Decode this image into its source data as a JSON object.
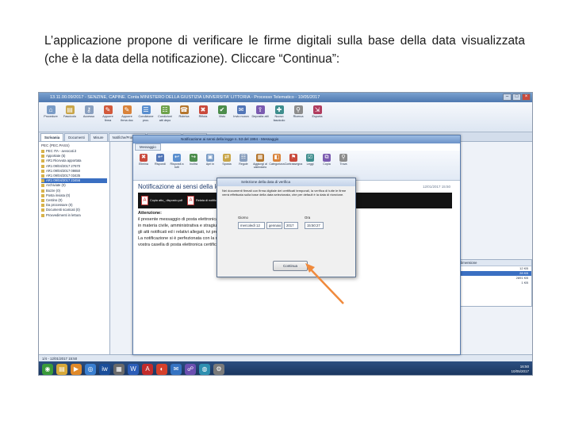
{
  "caption": "L’applicazione propone di verificare le firme digitali sulla base della data visualizzata (che è la data della notificazione). Cliccare “Continua”:",
  "app": {
    "title": "13.11.00.09/2017 - SENZINE, CAPINE. Conta MINISTERO DELLA GIUSTIZIA UNIVERSITA' LITTORIA - Processo Telematico - 10/05/2017"
  },
  "ribbon": [
    {
      "label": "Procedure",
      "icon": "⌂",
      "color": "#7a9cc6"
    },
    {
      "label": "Fascicolo",
      "icon": "▤",
      "color": "#c9a64a"
    },
    {
      "label": "Accesso",
      "icon": "⚷",
      "color": "#8aa0bf"
    },
    {
      "label": "Apporre firma",
      "icon": "✎",
      "color": "#d25a3c"
    },
    {
      "label": "Apporre firma doc",
      "icon": "✎",
      "color": "#d9833b"
    },
    {
      "label": "Condizione proc.",
      "icon": "☰",
      "color": "#5a8fcf"
    },
    {
      "label": "Condizioni atti depo",
      "icon": "☷",
      "color": "#6ea24b"
    },
    {
      "label": "Rubrica",
      "icon": "☎",
      "color": "#b4762e"
    },
    {
      "label": "Rifiuta",
      "icon": "✖",
      "color": "#c94a3c"
    },
    {
      "label": "Visto",
      "icon": "✔",
      "color": "#4c8d4c"
    },
    {
      "label": "Invio nuovo",
      "icon": "✉",
      "color": "#5276b7"
    },
    {
      "label": "Deposita atti",
      "icon": "⇪",
      "color": "#7b5bb0"
    },
    {
      "label": "Nuovo fascicolo",
      "icon": "✚",
      "color": "#3f8e8e"
    },
    {
      "label": "Ricerca",
      "icon": "⚲",
      "color": "#8c8c8c"
    },
    {
      "label": "Esporta",
      "icon": "⇲",
      "color": "#b03c5e"
    }
  ],
  "tabs": [
    {
      "label": "Scrivania",
      "active": true
    },
    {
      "label": "Documenti",
      "active": false
    },
    {
      "label": "Misure",
      "active": false
    },
    {
      "label": "Notifiche/Procedure",
      "active": false
    },
    {
      "label": "Gestione fascicoli",
      "active": false
    },
    {
      "label": "Calendario",
      "active": false
    }
  ],
  "sidebar": {
    "header": "PEC (PEC.PASS)",
    "items": [
      {
        "label": "PEC ITA - avvocati.it",
        "selected": false
      },
      {
        "label": "Apportate (5)",
        "selected": false
      },
      {
        "label": "AR1 Ricevuta apportata",
        "selected": false
      },
      {
        "label": "AR1 09/04/2017 27670",
        "selected": false
      },
      {
        "label": "AR1 09/04/2017 08650",
        "selected": false
      },
      {
        "label": "AR1 09/04/2017 03435",
        "selected": false
      },
      {
        "label": "AR1 09/04/2017 23456",
        "selected": true
      },
      {
        "label": "Archiviate (0)",
        "selected": false
      },
      {
        "label": "Bozze (0)",
        "selected": false
      },
      {
        "label": "Posta inviata (0)",
        "selected": false
      },
      {
        "label": "Cestino (0)",
        "selected": false
      },
      {
        "label": "Da processare (0)",
        "selected": false
      },
      {
        "label": "Documenti scaricati (0)",
        "selected": false
      },
      {
        "label": "Provvedimenti in lettura",
        "selected": false
      }
    ]
  },
  "message_window": {
    "title": "Notificazione ai sensi della legge n. 53 del 1994 - Messaggio",
    "tab": "Messaggio",
    "ribbon": [
      {
        "label": "Elimina",
        "icon": "✖",
        "color": "#c94a3c"
      },
      {
        "label": "Rispondi",
        "icon": "↩",
        "color": "#5276b7"
      },
      {
        "label": "Rispondi a tutti",
        "icon": "↩",
        "color": "#5a8fcf"
      },
      {
        "label": "Inoltra",
        "icon": "↪",
        "color": "#4c8d4c"
      },
      {
        "label": "Apri in",
        "icon": "▣",
        "color": "#7a9cc6"
      },
      {
        "label": "Sposta",
        "icon": "⇄",
        "color": "#c9a64a"
      },
      {
        "label": "Regole",
        "icon": "☷",
        "color": "#8aa0bf"
      },
      {
        "label": "Aggiungi al calendario",
        "icon": "▦",
        "color": "#b4762e"
      },
      {
        "label": "Categorizza",
        "icon": "◧",
        "color": "#d9833b"
      },
      {
        "label": "Contrassegna",
        "icon": "⚑",
        "color": "#c94a3c"
      },
      {
        "label": "Leggi",
        "icon": "☑",
        "color": "#3f8e8e"
      },
      {
        "label": "Copia",
        "icon": "⧉",
        "color": "#7b5bb0"
      },
      {
        "label": "Trova",
        "icon": "⚲",
        "color": "#8c8c8c"
      }
    ],
    "subject": "Notificazione ai sensi della legge n. 53 del 1994",
    "date": "12/01/2017 15:50",
    "attachments": [
      {
        "name": "Copia atto_ disposto.pdf"
      },
      {
        "name": "Relata di notifica.pdf"
      },
      {
        "name": "Procura.pdf"
      }
    ],
    "body": {
      "heading": "Attenzione:",
      "lines": [
        "il presente messaggio di posta elettronica contiene una notificazione ai sensi della legge n. 53 del 1994 da parte",
        "in materia civile, amministrativa e stragiudiziale da parte dell'avvocato notificante. Il messaggio contiene",
        "gli atti notificati ed i relativi allegati, ivi presente la relata di notifica.",
        "La notificazione si è perfezionata con la ricezione del presente messaggio da parte del sottoscritto, per le",
        "vostra casella di posta elettronica certificata."
      ]
    }
  },
  "dialog": {
    "title": "Selezione della data di verifica",
    "text": "Nei documenti firmati con firma digitale dei certificati temporali, la verifica di tutte le firme verrà effettuata sulla base della data selezionata, che per default è la data di ricezione.",
    "date_label": "Giorno",
    "time_label": "Ora",
    "day_value": "mercoledì 12",
    "month_value": "gennaio",
    "year_value": "2017",
    "time_value": "15:50:27",
    "button": "Continua"
  },
  "rightpane": {
    "header": "dimensione",
    "rows": [
      {
        "value": "12 KB",
        "selected": false
      },
      {
        "value": "28 KB",
        "selected": true
      },
      {
        "value": "2891 KB",
        "selected": false
      },
      {
        "value": "1 KB",
        "selected": false
      }
    ]
  },
  "status_text": "1/4 - 12/01/2017 15:50",
  "taskbar": [
    {
      "name": "start-icon",
      "glyph": "◉",
      "color": "#3a9a3a"
    },
    {
      "name": "explorer-icon",
      "glyph": "▤",
      "color": "#d7a93a"
    },
    {
      "name": "media-icon",
      "glyph": "▶",
      "color": "#e08a2a"
    },
    {
      "name": "browser-icon",
      "glyph": "◎",
      "color": "#3a7fd0"
    },
    {
      "name": "app-icon",
      "glyph": "iw",
      "color": "#1a4e9a"
    },
    {
      "name": "document-icon",
      "glyph": "▦",
      "color": "#6a6a6a"
    },
    {
      "name": "word-icon",
      "glyph": "W",
      "color": "#2b5db8"
    },
    {
      "name": "pdf-icon",
      "glyph": "A",
      "color": "#c22b2b"
    },
    {
      "name": "chrome-icon",
      "glyph": "◐",
      "color": "#d5402b"
    },
    {
      "name": "mail-icon",
      "glyph": "✉",
      "color": "#3573c2"
    },
    {
      "name": "network-icon",
      "glyph": "☍",
      "color": "#6b4fb0"
    },
    {
      "name": "globe-icon",
      "glyph": "◍",
      "color": "#2e8fb0"
    },
    {
      "name": "settings-icon",
      "glyph": "⚙",
      "color": "#7a7a7a"
    }
  ],
  "clock": {
    "time": "16:50",
    "date": "10/05/2017"
  }
}
